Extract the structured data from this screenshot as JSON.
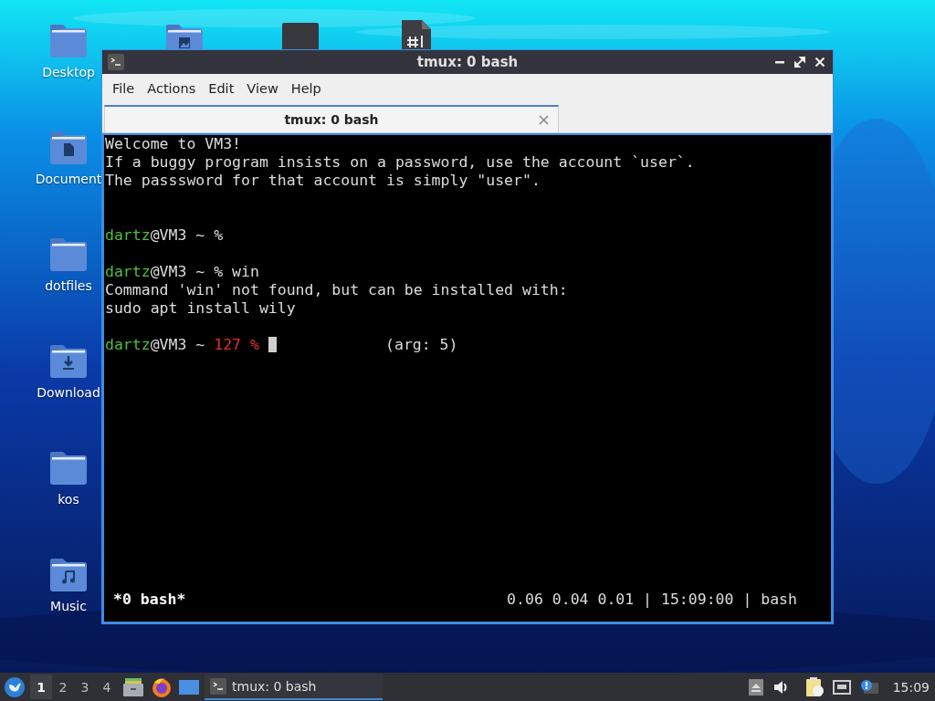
{
  "desktop_icons": [
    {
      "kind": "folder",
      "label": "Desktop"
    },
    {
      "kind": "picture-folder"
    },
    {
      "kind": "dark-file"
    },
    {
      "kind": "script-file"
    },
    {
      "kind": "document-folder",
      "label": "Document"
    },
    {
      "kind": "folder",
      "label": "dotfiles"
    },
    {
      "kind": "download-folder",
      "label": "Download"
    },
    {
      "kind": "folder",
      "label": "kos"
    },
    {
      "kind": "music-folder",
      "label": "Music"
    }
  ],
  "window": {
    "title": "tmux: 0 bash",
    "menu": [
      "File",
      "Actions",
      "Edit",
      "View",
      "Help"
    ],
    "tabs": [
      {
        "label": "tmux: 0 bash",
        "selected": true
      }
    ],
    "terminal": {
      "lines": [
        {
          "kind": "text",
          "segments": [
            {
              "kind": "plain",
              "text": "Welcome to VM3!"
            }
          ]
        },
        {
          "kind": "text",
          "segments": [
            {
              "kind": "plain",
              "text": "If a buggy program insists on a password, use the account `user`."
            }
          ]
        },
        {
          "kind": "text",
          "segments": [
            {
              "kind": "plain",
              "text": "The passsword for that account is simply \"user\"."
            }
          ]
        },
        {
          "kind": "blank"
        },
        {
          "kind": "blank"
        },
        {
          "kind": "text",
          "segments": [
            {
              "kind": "user",
              "text": "dartz"
            },
            {
              "kind": "plain",
              "text": "@VM3 ~ %"
            }
          ]
        },
        {
          "kind": "blank"
        },
        {
          "kind": "text",
          "segments": [
            {
              "kind": "user",
              "text": "dartz"
            },
            {
              "kind": "plain",
              "text": "@VM3 ~ % win"
            }
          ]
        },
        {
          "kind": "text",
          "segments": [
            {
              "kind": "plain",
              "text": "Command 'win' not found, but can be installed with:"
            }
          ]
        },
        {
          "kind": "text",
          "segments": [
            {
              "kind": "plain",
              "text": "sudo apt install wily"
            }
          ]
        },
        {
          "kind": "blank"
        },
        {
          "kind": "text",
          "segments": [
            {
              "kind": "user",
              "text": "dartz"
            },
            {
              "kind": "plain",
              "text": "@VM3 ~ "
            },
            {
              "kind": "error",
              "text": "127 %"
            },
            {
              "kind": "cursor"
            },
            {
              "kind": "plain",
              "text": "            (arg: 5)"
            }
          ]
        }
      ],
      "status_left": "*0 bash*",
      "status_right": "0.06 0.04 0.01 | 15:09:00 | bash"
    }
  },
  "taskbar": {
    "workspaces": [
      {
        "label": "1",
        "selected": true
      },
      {
        "label": "2",
        "selected": false
      },
      {
        "label": "3",
        "selected": false
      },
      {
        "label": "4",
        "selected": false
      }
    ],
    "tasks": [
      {
        "label": "tmux: 0 bash",
        "selected": true
      }
    ],
    "clock": "15:09"
  }
}
